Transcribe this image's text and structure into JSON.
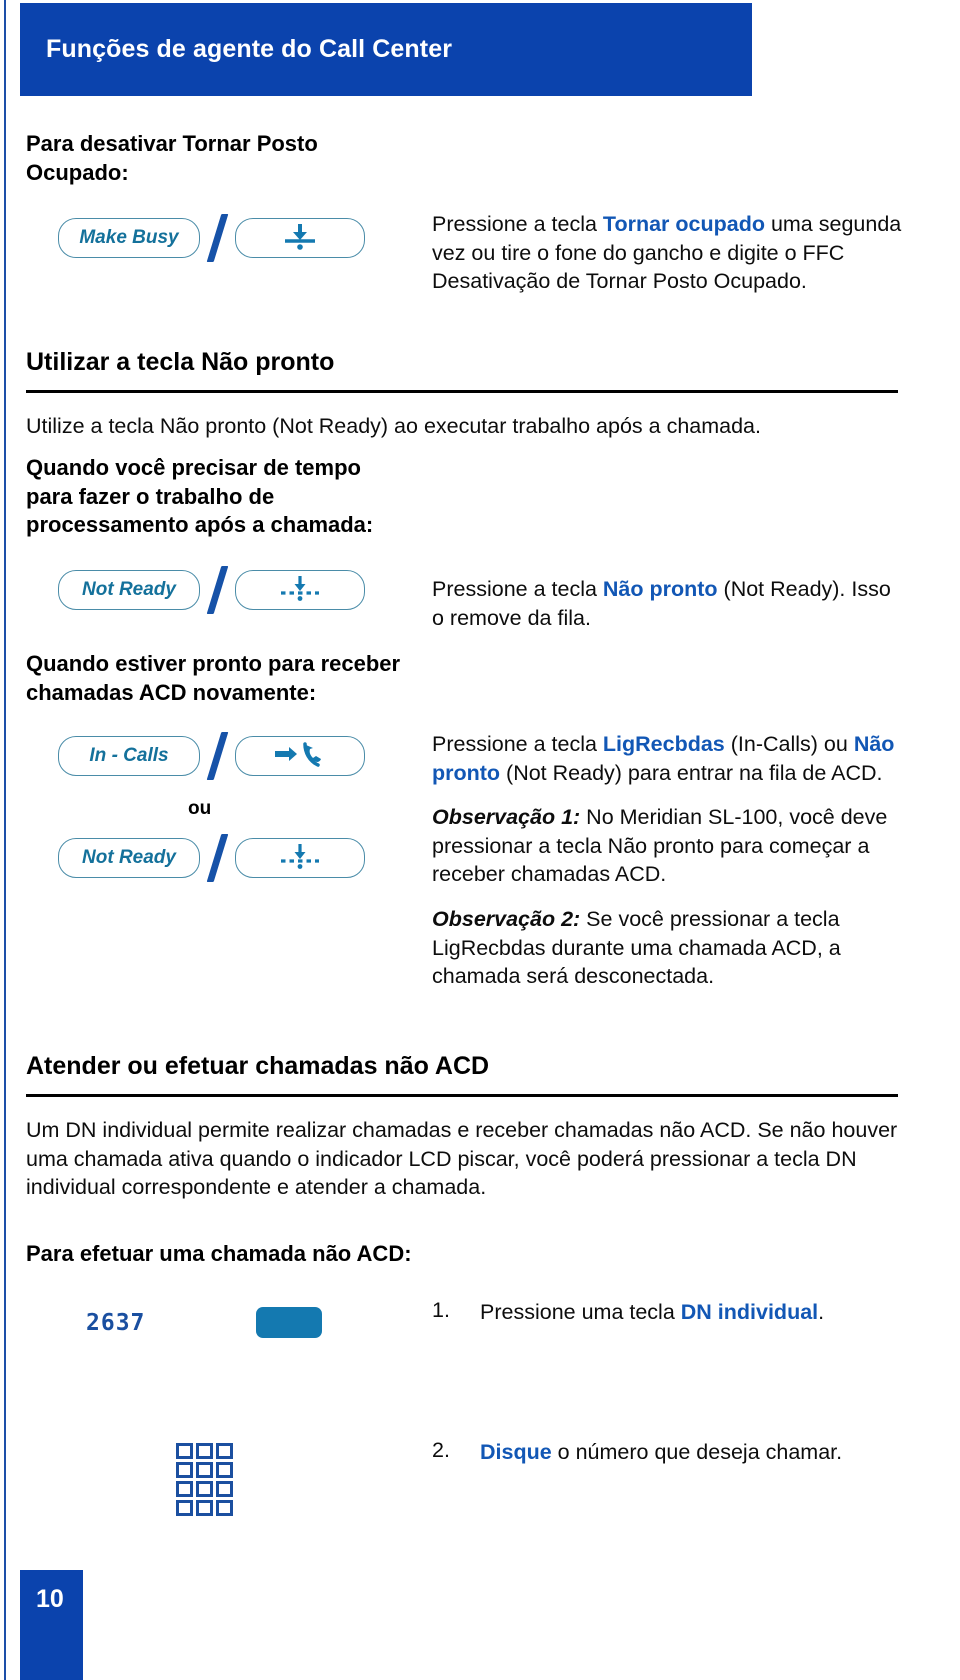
{
  "header": {
    "title": "Funções de agente do Call Center"
  },
  "make_busy": {
    "lead": "Para desativar Tornar Posto Ocupado:",
    "key_label": "Make Busy",
    "key_icon": "make-busy-down-arrow-icon",
    "separator": "/",
    "instruction_pre": "Pressione a tecla ",
    "instruction_bold": "Tornar ocupado",
    "instruction_post": " uma segunda vez ou tire o fone do gancho e digite o FFC Desativação de Tornar Posto Ocupado."
  },
  "not_ready_section": {
    "heading": "Utilizar a tecla Não pronto",
    "intro": "Utilize a tecla Não pronto (Not Ready) ao executar trabalho após a chamada.",
    "lead": "Quando você precisar de tempo para fazer o trabalho de processamento após a chamada:",
    "key_label": "Not Ready",
    "key_icon": "not-ready-dashed-down-arrow-icon",
    "separator": "/",
    "instruction_pre": "Pressione a tecla ",
    "instruction_bold": "Não pronto",
    "instruction_post": " (Not Ready). Isso o remove da fila."
  },
  "in_calls_section": {
    "lead": "Quando estiver pronto para receber chamadas ACD novamente:",
    "key_label_1": "In - Calls",
    "key_icon_1": "incoming-call-handset-icon",
    "or_label": "ou",
    "key_label_2": "Not Ready",
    "key_icon_2": "not-ready-dashed-down-arrow-icon",
    "separator": "/",
    "instruction_pre": "Pressione a tecla ",
    "instruction_bold_1": "LigRecbdas",
    "instruction_mid": " (In-Calls) ou ",
    "instruction_bold_2": "Não pronto",
    "instruction_post": " (Not Ready) para entrar na fila de ACD.",
    "note1_lead": "Observação 1:",
    "note1_body": " No Meridian SL-100, você deve pressionar a tecla Não pronto para começar a receber chamadas ACD.",
    "note2_lead": "Observação 2:",
    "note2_body": " Se você pressionar a tecla LigRecbdas durante uma chamada ACD, a chamada será desconectada."
  },
  "non_acd_section": {
    "heading": "Atender ou efetuar chamadas não ACD",
    "paragraph": "Um DN individual permite realizar chamadas e receber chamadas não ACD. Se não houver uma chamada ativa quando o indicador LCD piscar, você poderá pressionar a tecla DN individual correspondente e atender a chamada.",
    "lead": "Para efetuar uma chamada não ACD:",
    "lcd_value": "2637",
    "dn_key_icon": "dn-line-key-icon",
    "keypad_icon": "dial-keypad-icon",
    "steps": [
      {
        "index": "1.",
        "pre": "Pressione uma tecla ",
        "bold": "DN individual",
        "post": "."
      },
      {
        "index": "2.",
        "pre": "",
        "bold": "Disque",
        "post": " o número que deseja chamar."
      }
    ]
  },
  "footer": {
    "page_number": "10"
  },
  "colors": {
    "brand_blue": "#0b43ad",
    "link_blue": "#1257b5",
    "key_outline": "#4a8ca8",
    "key_text": "#14719b",
    "icon_blue": "#1479b0"
  }
}
